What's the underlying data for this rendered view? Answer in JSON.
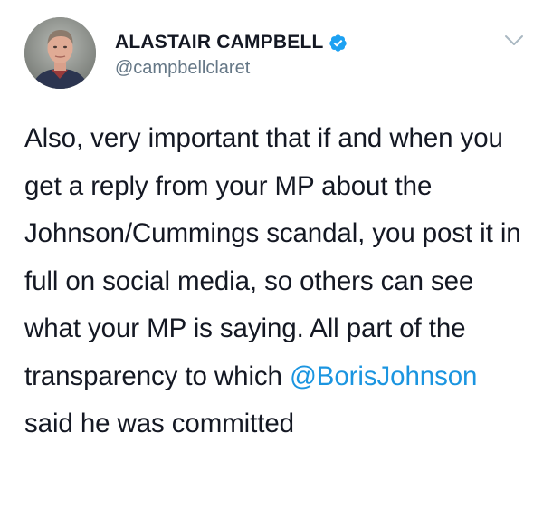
{
  "author": {
    "display_name": "ALASTAIR CAMPBELL",
    "handle": "@campbellclaret",
    "verified": true,
    "avatar_icon": "profile-photo",
    "verified_icon": "verified-badge-icon"
  },
  "tweet": {
    "text_before_mention": "Also, very important that if and when you get a reply from your MP about the Johnson/Cummings scandal, you post it in full on social media, so others can see what your MP is saying. All part of the transparency to which ",
    "mention": "@BorisJohnson",
    "text_after_mention": " said he was committed"
  },
  "menu": {
    "icon": "chevron-down-icon"
  },
  "colors": {
    "text": "#141823",
    "secondary_text": "#657786",
    "link": "#1b95e0",
    "verified_badge": "#1da1f2",
    "background": "#ffffff"
  }
}
